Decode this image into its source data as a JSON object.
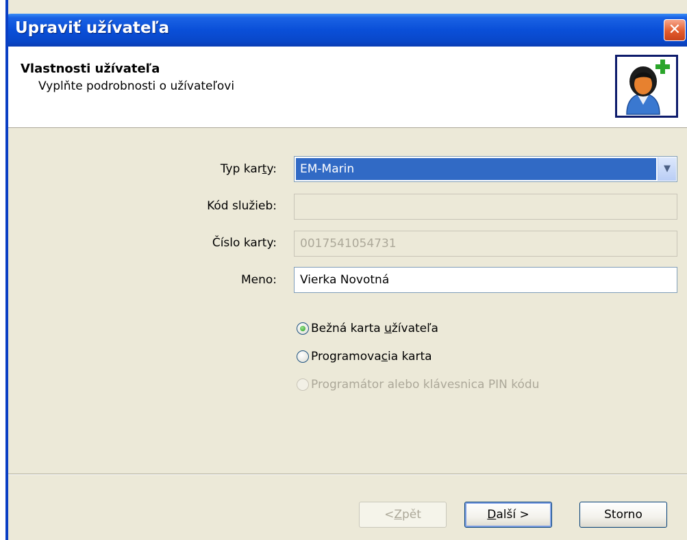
{
  "window": {
    "title": "Upraviť užívateľa",
    "close_glyph": "✕"
  },
  "header": {
    "title": "Vlastnosti užívateľa",
    "subtitle": "Vyplňte podrobnosti o užívateľovi",
    "icon": "add-user-icon"
  },
  "form": {
    "card_type": {
      "label_pre": "Typ kar",
      "label_accel": "t",
      "label_post": "y:",
      "value": "EM-Marin"
    },
    "service_code": {
      "label": "Kód služieb:",
      "value": ""
    },
    "card_number": {
      "label": "Číslo karty:",
      "value": "0017541054731"
    },
    "name": {
      "label": "Meno:",
      "value": "Vierka Novotná"
    }
  },
  "radios": [
    {
      "pre": "Bežná karta ",
      "accel": "u",
      "post": "žívateľa",
      "checked": true,
      "enabled": true
    },
    {
      "pre": "Programova",
      "accel": "c",
      "post": "ia karta",
      "checked": false,
      "enabled": true
    },
    {
      "pre": "Programátor alebo klávesnica PIN kódu",
      "accel": "",
      "post": "",
      "checked": false,
      "enabled": false
    }
  ],
  "buttons": {
    "back": {
      "pre": "< ",
      "accel": "Z",
      "post": "pět"
    },
    "next": {
      "pre": "",
      "accel": "D",
      "post": "alší >"
    },
    "cancel": {
      "label": "Storno"
    }
  },
  "colors": {
    "titlebar": "#0a4fd8",
    "selection": "#316ac5",
    "dialog_bg": "#ece9d8",
    "radio_checked": "#21a121",
    "disabled_text": "#aca899"
  }
}
